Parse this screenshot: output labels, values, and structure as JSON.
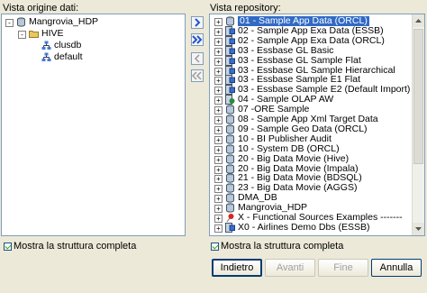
{
  "left": {
    "title": "Vista origine dati:",
    "tree": [
      {
        "label": "Mangrovia_HDP",
        "level": 0,
        "expander": "-",
        "icon": "database-icon",
        "selected": false
      },
      {
        "label": "HIVE",
        "level": 1,
        "expander": "-",
        "icon": "folder-icon",
        "selected": false
      },
      {
        "label": "clusdb",
        "level": 2,
        "expander": "",
        "icon": "schema-icon",
        "selected": false
      },
      {
        "label": "default",
        "level": 2,
        "expander": "",
        "icon": "schema-icon",
        "selected": false
      }
    ],
    "checkbox_label": "Mostra la struttura completa"
  },
  "right": {
    "title": "Vista repository:",
    "items": [
      {
        "label": "01 - Sample App Data (ORCL)",
        "icon": "database-icon",
        "selected": true
      },
      {
        "label": "02 - Sample App Exa Data (ESSB)",
        "icon": "cube-db-icon",
        "selected": false
      },
      {
        "label": "02 - Sample App Exa Data (ORCL)",
        "icon": "cube-db-icon",
        "selected": false
      },
      {
        "label": "03 - Essbase GL Basic",
        "icon": "cube-db-icon",
        "selected": false
      },
      {
        "label": "03 - Essbase GL Sample Flat",
        "icon": "cube-db-icon",
        "selected": false
      },
      {
        "label": "03 - Essbase GL Sample Hierarchical",
        "icon": "cube-db-icon",
        "selected": false
      },
      {
        "label": "03 - Essbase Sample E1 Flat",
        "icon": "cube-db-icon",
        "selected": false
      },
      {
        "label": "03 - Essbase Sample E2 (Default Import)",
        "icon": "cube-db-icon",
        "selected": false
      },
      {
        "label": "04 - Sample OLAP AW",
        "icon": "olap-icon",
        "selected": false
      },
      {
        "label": "07 -ORE Sample",
        "icon": "database-icon",
        "selected": false
      },
      {
        "label": "08 - Sample App Xml Target Data",
        "icon": "database-icon",
        "selected": false
      },
      {
        "label": "09 - Sample Geo Data (ORCL)",
        "icon": "database-icon",
        "selected": false
      },
      {
        "label": "10 - BI Publisher Audit",
        "icon": "database-icon",
        "selected": false
      },
      {
        "label": "10 - System DB (ORCL)",
        "icon": "database-icon",
        "selected": false
      },
      {
        "label": "20 - Big Data Movie (Hive)",
        "icon": "database-icon",
        "selected": false
      },
      {
        "label": "20 - Big Data Movie (Impala)",
        "icon": "database-icon",
        "selected": false
      },
      {
        "label": "21 - Big Data Movie (BDSQL)",
        "icon": "database-icon",
        "selected": false
      },
      {
        "label": "23 - Big Data Movie (AGGS)",
        "icon": "database-icon",
        "selected": false
      },
      {
        "label": "DMA_DB",
        "icon": "database-icon",
        "selected": false
      },
      {
        "label": "Mangrovia_HDP",
        "icon": "database-icon",
        "selected": false
      },
      {
        "label": "X - Functional Sources Examples -------",
        "icon": "pin-icon",
        "selected": false
      },
      {
        "label": "X0 - Airlines Demo Dbs (ESSB)",
        "icon": "cube-db-icon",
        "selected": false
      }
    ],
    "checkbox_label": "Mostra la struttura completa"
  },
  "buttons": {
    "back": "Indietro",
    "next": "Avanti",
    "finish": "Fine",
    "cancel": "Annulla"
  },
  "colors": {
    "selection": "#316ac5",
    "dialog_bg": "#ece9d8",
    "arrow_blue": "#2255cc"
  }
}
